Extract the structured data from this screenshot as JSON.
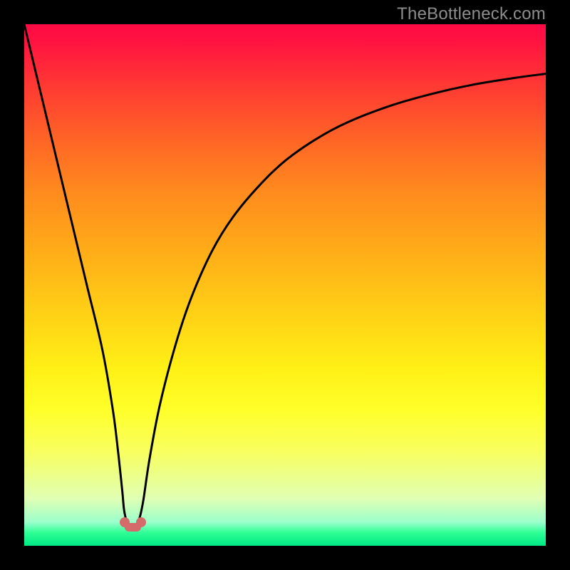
{
  "watermark": "TheBottleneck.com",
  "chart_data": {
    "type": "line",
    "title": "",
    "xlabel": "",
    "ylabel": "",
    "xlim": [
      0,
      100
    ],
    "ylim": [
      0,
      100
    ],
    "series": [
      {
        "name": "bottleneck-curve",
        "x": [
          0,
          3,
          6,
          9,
          12,
          15,
          17,
          18,
          18.8,
          19.2,
          20,
          21,
          22,
          22.8,
          24,
          26,
          29,
          32,
          36,
          40,
          45,
          50,
          56,
          62,
          70,
          78,
          86,
          94,
          100
        ],
        "values": [
          100,
          87.5,
          75,
          62.5,
          50,
          37.5,
          26,
          18,
          10.5,
          6.5,
          3.8,
          3.6,
          5.0,
          8.5,
          16.5,
          27,
          38.5,
          47.5,
          56.5,
          63,
          69,
          73.8,
          78,
          81.2,
          84.3,
          86.6,
          88.4,
          89.7,
          90.5
        ]
      }
    ],
    "markers": [
      {
        "name": "marker-left",
        "x": 19.2,
        "y": 4.5
      },
      {
        "name": "marker-right",
        "x": 22.4,
        "y": 4.5
      }
    ],
    "gradient_stops": [
      {
        "pct": 0,
        "color": "#ff0a45"
      },
      {
        "pct": 66,
        "color": "#ffff2a"
      },
      {
        "pct": 97,
        "color": "#2eff95"
      },
      {
        "pct": 100,
        "color": "#00e884"
      }
    ]
  }
}
